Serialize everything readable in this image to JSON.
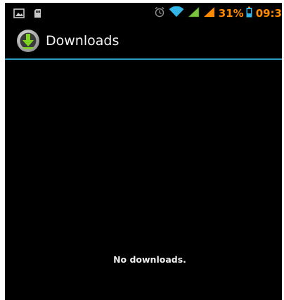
{
  "status_bar": {
    "left_icons": [
      "image-notification-icon",
      "sd-card-icon"
    ],
    "right_icons": [
      "alarm-icon",
      "wifi-icon",
      "signal-icon",
      "signal-orange-icon",
      "battery-icon"
    ],
    "battery_percent": "31%",
    "clock": "09:3"
  },
  "action_bar": {
    "icon": "download-app-icon",
    "title": "Downloads"
  },
  "content": {
    "empty_message": "No downloads."
  },
  "colors": {
    "background": "#000000",
    "divider": "#2f9bbd",
    "status_accent": "#ff8a00",
    "signal_green": "#79c33f",
    "title_text": "#f2f2f2"
  }
}
